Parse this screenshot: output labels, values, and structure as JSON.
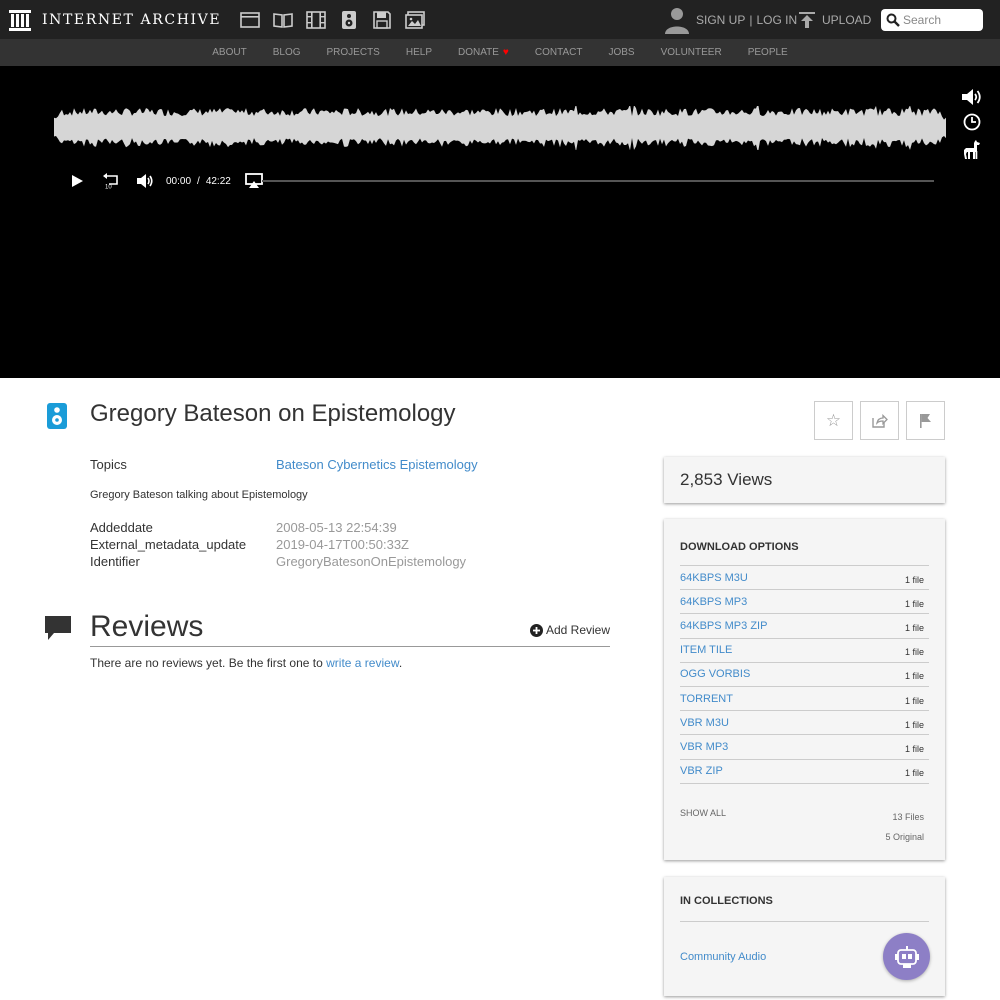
{
  "header": {
    "logo_text": "INTERNET ARCHIVE",
    "media_icons": [
      "web-icon",
      "texts-icon",
      "video-icon",
      "audio-icon",
      "software-icon",
      "images-icon"
    ],
    "signup_label": "SIGN UP",
    "auth_separator": "|",
    "login_label": "LOG IN",
    "upload_label": "UPLOAD",
    "search_placeholder": "Search"
  },
  "nav": {
    "items": [
      "ABOUT",
      "BLOG",
      "PROJECTS",
      "HELP",
      "DONATE",
      "CONTACT",
      "JOBS",
      "VOLUNTEER",
      "PEOPLE"
    ]
  },
  "player": {
    "current_time": "00:00",
    "time_separator": "/",
    "duration": "42:22",
    "progress": 0
  },
  "item": {
    "title": "Gregory Bateson on Epistemology",
    "type_icon": "audio-icon",
    "metadata": {
      "topics_label": "Topics",
      "topics_value": "Bateson Cybernetics Epistemology",
      "description": "Gregory Bateson talking about Epistemology",
      "rows": [
        {
          "key": "Addeddate",
          "value": "2008-05-13 22:54:39"
        },
        {
          "key": "External_metadata_update",
          "value": "2019-04-17T00:50:33Z"
        },
        {
          "key": "Identifier",
          "value": "GregoryBatesonOnEpistemology"
        }
      ]
    }
  },
  "reviews": {
    "title": "Reviews",
    "add_label": "Add Review",
    "empty_prefix": "There are no reviews yet. Be the first one to ",
    "empty_link": "write a review",
    "empty_suffix": "."
  },
  "sidebar": {
    "views": "2,853 Views",
    "download_title": "DOWNLOAD OPTIONS",
    "downloads": [
      {
        "label": "64KBPS M3U",
        "count": "1 file"
      },
      {
        "label": "64KBPS MP3",
        "count": "1 file"
      },
      {
        "label": "64KBPS MP3 ZIP",
        "count": "1 file"
      },
      {
        "label": "ITEM TILE",
        "count": "1 file"
      },
      {
        "label": "OGG VORBIS",
        "count": "1 file"
      },
      {
        "label": "TORRENT",
        "count": "1 file"
      },
      {
        "label": "VBR M3U",
        "count": "1 file"
      },
      {
        "label": "VBR MP3",
        "count": "1 file"
      },
      {
        "label": "VBR ZIP",
        "count": "1 file"
      }
    ],
    "show_all": "SHOW ALL",
    "files_count": "13 Files",
    "original_count": "5 Original",
    "collections_title": "IN COLLECTIONS",
    "collection": "Community Audio"
  },
  "colors": {
    "accent": "#428bca",
    "topbar": "#222222",
    "navbar": "#333333",
    "fab": "#8d7fc6",
    "audio_icon": "#1a9cd8"
  }
}
